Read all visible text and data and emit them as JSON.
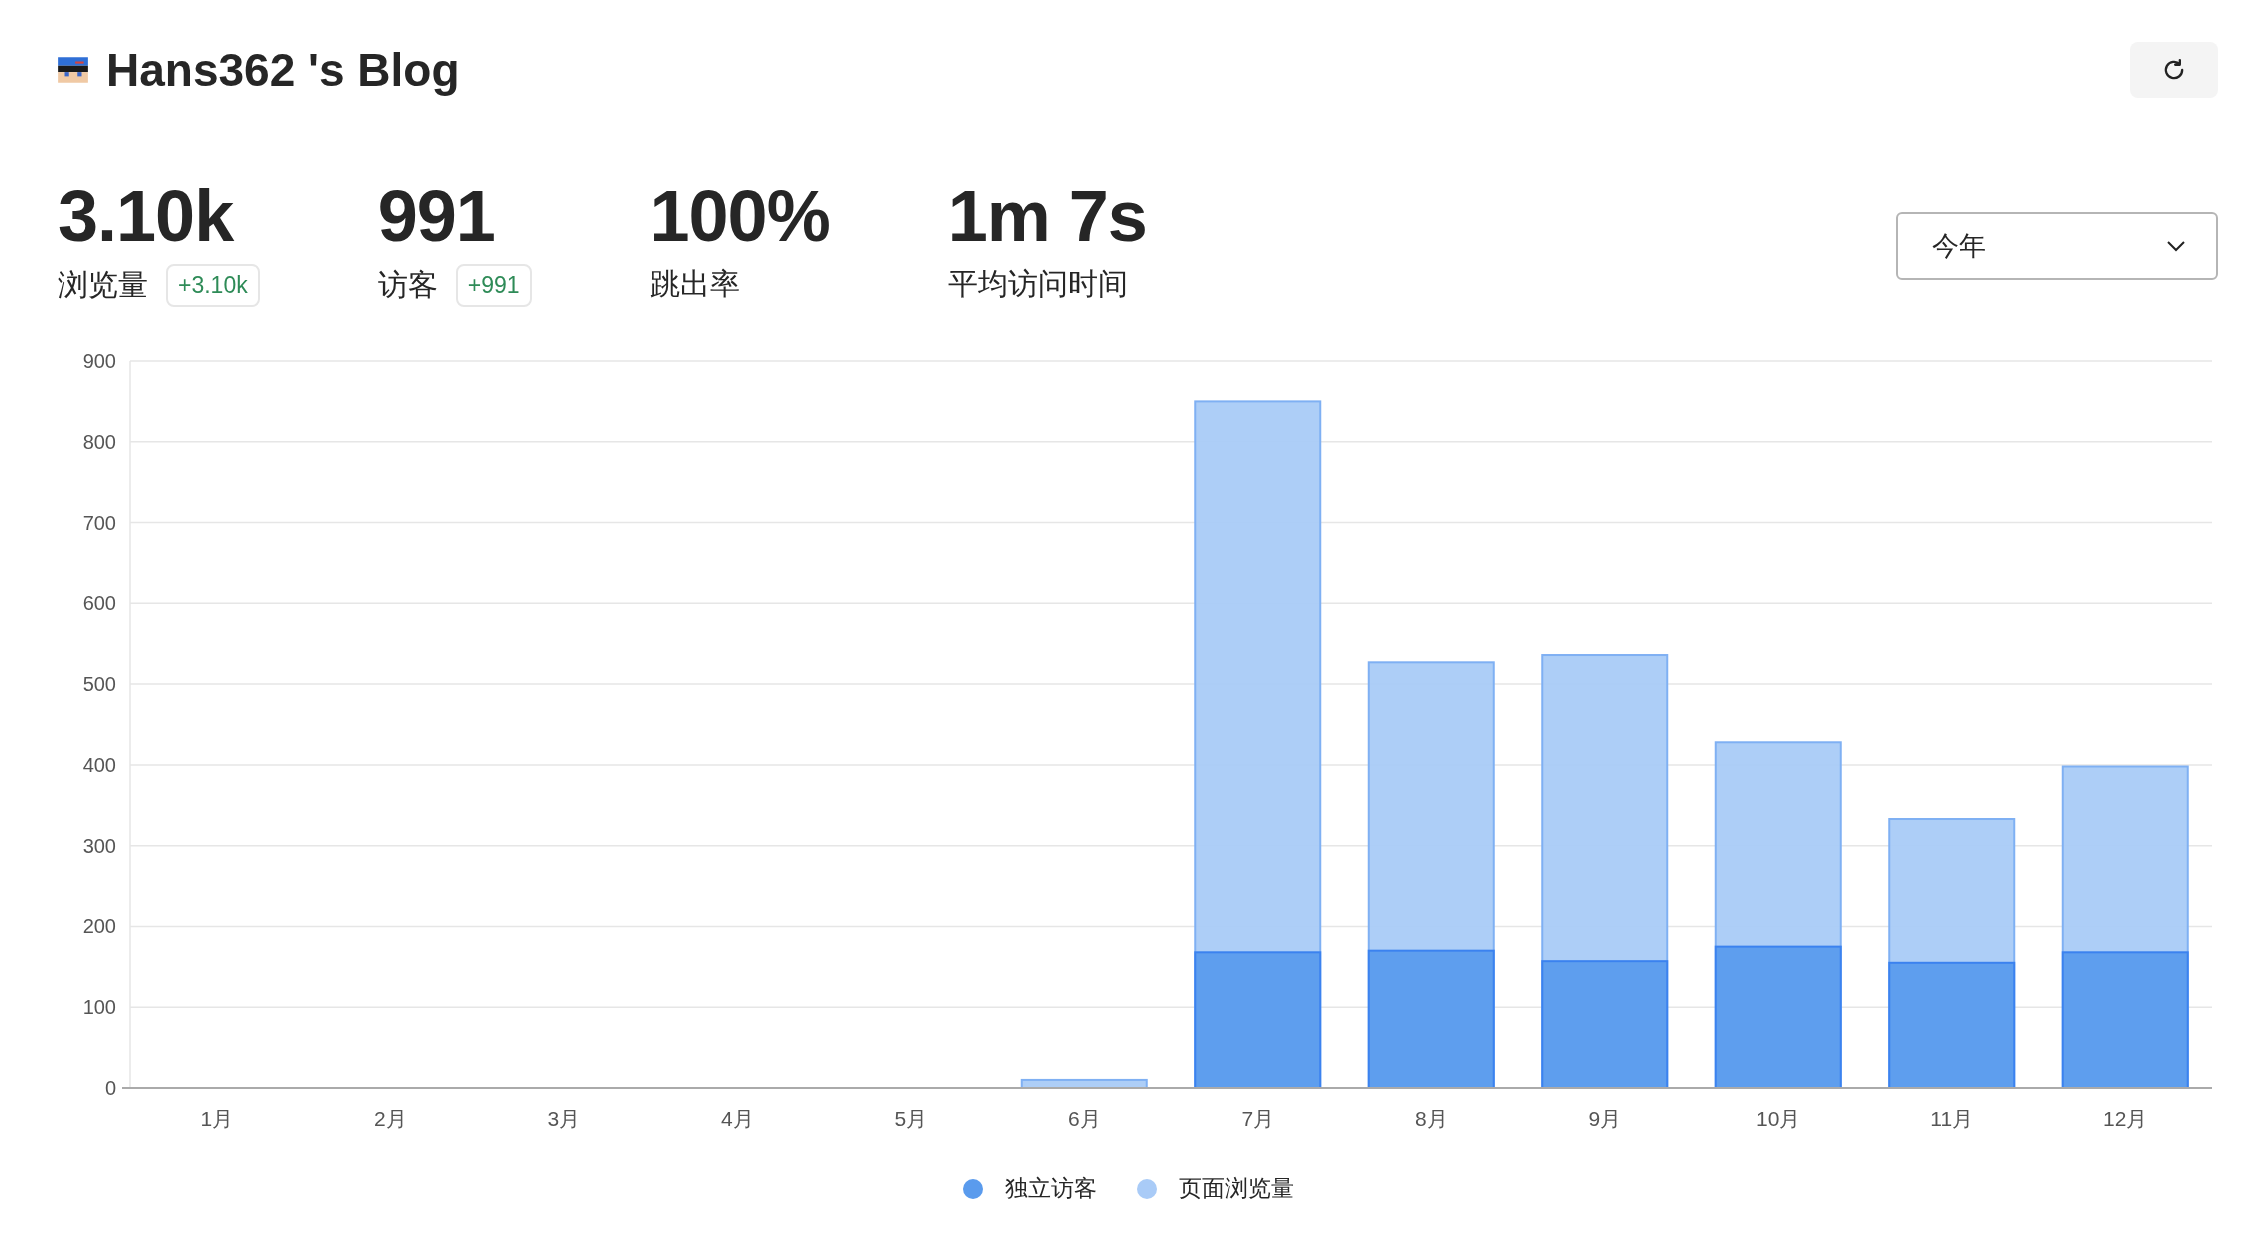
{
  "header": {
    "title": "Hans362 's Blog"
  },
  "stats": [
    {
      "value": "3.10k",
      "label": "浏览量",
      "change": "+3.10k"
    },
    {
      "value": "991",
      "label": "访客",
      "change": "+991"
    },
    {
      "value": "100%",
      "label": "跳出率"
    },
    {
      "value": "1m 7s",
      "label": "平均访问时间"
    }
  ],
  "period_select": {
    "value": "今年"
  },
  "chart_data": {
    "type": "bar",
    "stacked": false,
    "categories": [
      "1月",
      "2月",
      "3月",
      "4月",
      "5月",
      "6月",
      "7月",
      "8月",
      "9月",
      "10月",
      "11月",
      "12月"
    ],
    "series": [
      {
        "name": "独立访客",
        "color": "#5a9bed",
        "values": [
          0,
          0,
          0,
          0,
          0,
          null,
          168,
          170,
          157,
          175,
          155,
          168
        ]
      },
      {
        "name": "页面浏览量",
        "color": "#a9cbf7",
        "values": [
          0,
          0,
          0,
          0,
          0,
          10,
          850,
          527,
          536,
          428,
          333,
          398
        ]
      }
    ],
    "grid": true,
    "ylim": [
      0,
      900
    ],
    "yticks": [
      0,
      100,
      200,
      300,
      400,
      500,
      600,
      700,
      800,
      900
    ]
  }
}
